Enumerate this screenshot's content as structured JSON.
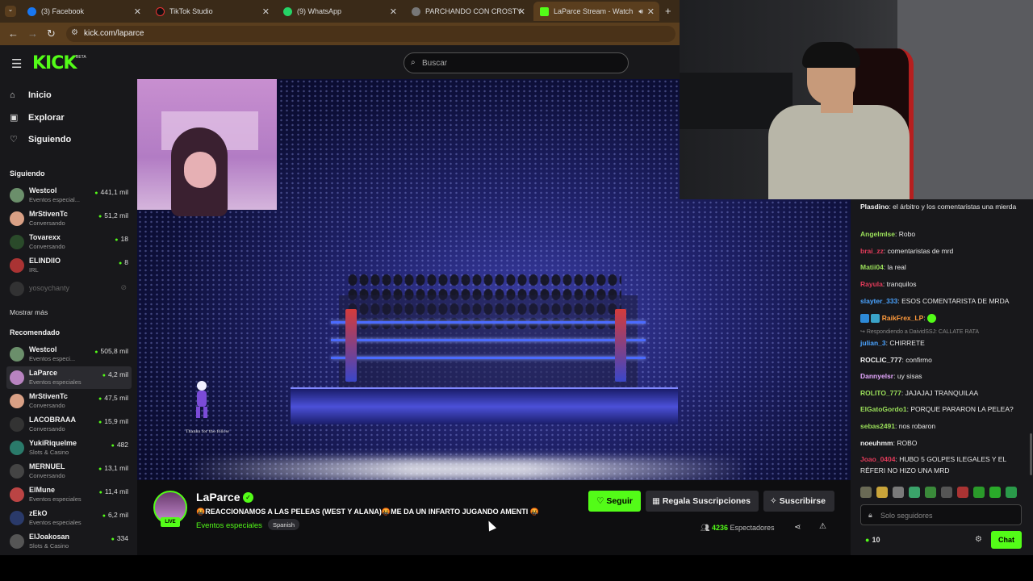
{
  "browser": {
    "tabs": [
      {
        "label": "(3) Facebook",
        "color": "#1877f2"
      },
      {
        "label": "TikTok Studio",
        "color": "#111111"
      },
      {
        "label": "(9) WhatsApp",
        "color": "#25d366"
      },
      {
        "label": "PARCHANDO CON CROSTY",
        "color": "#888888"
      },
      {
        "label": "LaParce Stream - Watch Liv",
        "color": "#53fc18"
      }
    ],
    "url": "kick.com/laparce"
  },
  "header": {
    "logo": "KICK",
    "beta": "BETA",
    "search_placeholder": "Buscar"
  },
  "sidebar": {
    "nav": [
      {
        "label": "Inicio",
        "icon": "home-icon"
      },
      {
        "label": "Explorar",
        "icon": "explore-icon"
      },
      {
        "label": "Siguiendo",
        "icon": "heart-icon"
      }
    ],
    "following_title": "Siguiendo",
    "following": [
      {
        "name": "Westcol",
        "category": "Eventos especial...",
        "viewers": "441,1 mil",
        "color": "#6b8f6b"
      },
      {
        "name": "MrStivenTc",
        "category": "Conversando",
        "viewers": "51,2 mil",
        "color": "#d9a085"
      },
      {
        "name": "Tovarexx",
        "category": "Conversando",
        "viewers": "18",
        "color": "#2a4a2a"
      },
      {
        "name": "ELINDIIO",
        "category": "IRL",
        "viewers": "8",
        "color": "#a33"
      },
      {
        "name": "yosoychanty",
        "category": "",
        "viewers": "",
        "color": "#444"
      }
    ],
    "show_more": "Mostrar más",
    "recommended_title": "Recomendado",
    "recommended": [
      {
        "name": "Westcol",
        "category": "Eventos especi...",
        "viewers": "505,8 mil",
        "color": "#6b8f6b"
      },
      {
        "name": "LaParce",
        "category": "Eventos especiales",
        "viewers": "4,2 mil",
        "color": "#b883c0"
      },
      {
        "name": "MrStivenTc",
        "category": "Conversando",
        "viewers": "47,5 mil",
        "color": "#d9a085"
      },
      {
        "name": "LACOBRAAA",
        "category": "Conversando",
        "viewers": "15,9 mil",
        "color": "#333"
      },
      {
        "name": "YukiRiquelme",
        "category": "Slots & Casino",
        "viewers": "482",
        "color": "#2a7a6a"
      },
      {
        "name": "MERNUEL",
        "category": "Conversando",
        "viewers": "13,1 mil",
        "color": "#444"
      },
      {
        "name": "ElMune",
        "category": "Eventos especiales",
        "viewers": "11,4 mil",
        "color": "#b44"
      },
      {
        "name": "zEkO",
        "category": "Eventos especiales",
        "viewers": "6,2 mil",
        "color": "#2a3a6a"
      },
      {
        "name": "ElJoakosan",
        "category": "Slots & Casino",
        "viewers": "334",
        "color": "#555"
      }
    ]
  },
  "video": {
    "overlay_follow_text": "Thanks for the follow"
  },
  "chat": {
    "messages": [
      {
        "user": "Plasdino",
        "text": "el árbitro y los comentaristas una mierda",
        "color": "#f1f1f1"
      },
      {
        "user": "AngelmIse",
        "text": "Robo",
        "color": "#9be05a"
      },
      {
        "user": "brai_zz",
        "text": "comentaristas de mrd",
        "color": "#e23b5a"
      },
      {
        "user": "Matii04",
        "text": "la real",
        "color": "#9be05a"
      },
      {
        "user": "Rayula",
        "text": "tranquilos",
        "color": "#e23b5a"
      },
      {
        "user": "slayter_333",
        "text": "ESOS COMENTARISTA DE MRDA",
        "color": "#4aa3ff"
      },
      {
        "user": "RaikFrex_LP",
        "text": "",
        "color": "#ff9a3c"
      },
      {
        "user": "julian_3",
        "text": "CHIRRETE",
        "color": "#4aa3ff"
      },
      {
        "user": "ROCLIC_777",
        "text": "confirmo",
        "color": "#f1f1f1"
      },
      {
        "user": "Dannyelsr",
        "text": "uy sisas",
        "color": "#e6a8ff"
      },
      {
        "user": "ROLITO_777",
        "text": "JAJAJAJ TRANQUILAA",
        "color": "#9be05a"
      },
      {
        "user": "ElGatoGordo1",
        "text": "PORQUE PARARON LA PELEA?",
        "color": "#9be05a"
      },
      {
        "user": "sebas2491",
        "text": "nos robaron",
        "color": "#9be05a"
      },
      {
        "user": "noeuhmm",
        "text": "ROBO",
        "color": "#f1f1f1"
      },
      {
        "user": "Joao_0404",
        "text": "HUBO 5 GOLPES ILEGALES Y EL RÉFERI NO HIZO UNA MRD",
        "color": "#e23b5a"
      }
    ],
    "reply_note": "Respondiendo a DaividSSJ: CALLATE RATA",
    "input_placeholder": "Solo seguidores",
    "points": "10",
    "send_label": "Chat"
  },
  "channel": {
    "name": "LaParce",
    "live_badge": "LIVE",
    "title": "🤬REACCIONAMOS A LAS PELEAS (WEST Y ALANA)🤬ME DA UN INFARTO JUGANDO AMENTI 🤬",
    "category": "Eventos especiales",
    "language": "Spanish",
    "follow_label": "Seguir",
    "gift_label": "Regala Suscripciones",
    "subscribe_label": "Suscribirse",
    "viewers": "4236",
    "viewers_label": "Espectadores"
  },
  "colors": {
    "brand": "#53fc18",
    "sidebar_bg": "#18181b",
    "page_bg": "#0e0e10"
  }
}
